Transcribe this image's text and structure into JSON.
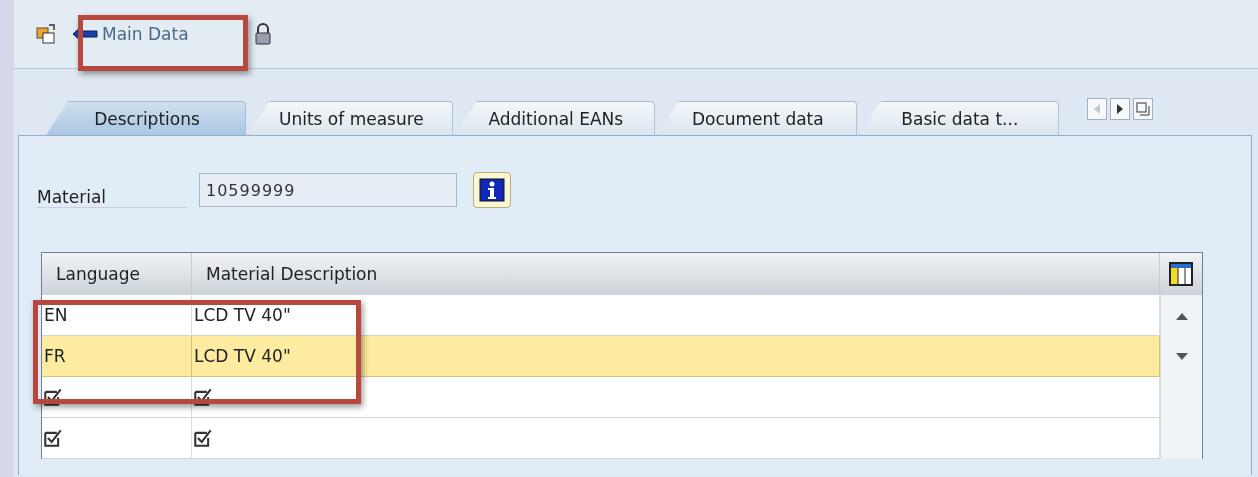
{
  "toolbar": {
    "back_button": "Main Data"
  },
  "tabs": [
    {
      "label": "Descriptions",
      "selected": true
    },
    {
      "label": "Units of measure",
      "selected": false
    },
    {
      "label": "Additional EANs",
      "selected": false
    },
    {
      "label": "Document data",
      "selected": false
    },
    {
      "label": "Basic data t...",
      "selected": false
    }
  ],
  "material": {
    "label": "Material",
    "value": "10599999"
  },
  "table": {
    "columns": [
      "Language",
      "Material Description"
    ],
    "rows": [
      {
        "kind": "filled",
        "language": "EN",
        "description": "LCD TV 40\"",
        "selected": false
      },
      {
        "kind": "filled",
        "language": "FR",
        "description": "LCD TV 40\"",
        "selected": true
      },
      {
        "kind": "new",
        "selected": false
      },
      {
        "kind": "new",
        "selected": false
      }
    ]
  }
}
